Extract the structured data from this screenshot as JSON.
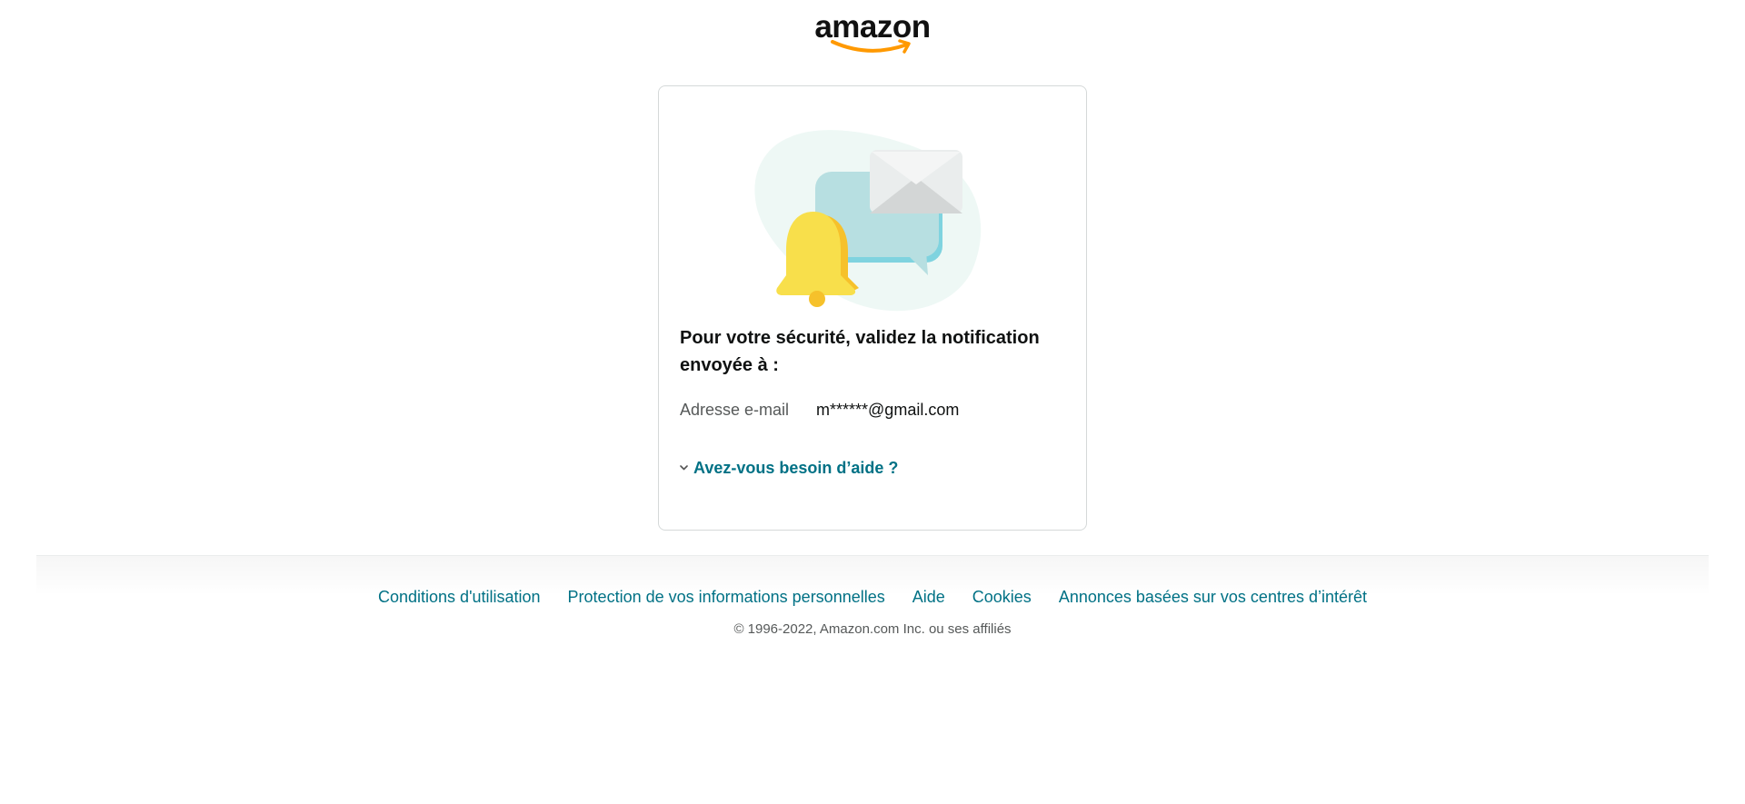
{
  "logo": {
    "text": "amazon",
    "accent_color": "#FF9900"
  },
  "card": {
    "heading": "Pour votre sécurité, validez la notification envoyée à :",
    "email_label": "Adresse e-mail",
    "email_value": "m******@gmail.com",
    "help_link": "Avez-vous besoin d’aide ?",
    "illustration_icons": [
      "bell-icon",
      "chat-bubble-icon",
      "envelope-icon"
    ]
  },
  "footer": {
    "links": [
      "Conditions d'utilisation",
      "Protection de vos informations personnelles",
      "Aide",
      "Cookies",
      "Annonces basées sur vos centres d’intérêt"
    ],
    "copyright": "© 1996-2022, Amazon.com Inc. ou ses affiliés"
  },
  "colors": {
    "link": "#007185",
    "text": "#0F1111",
    "muted": "#565959",
    "border": "#D5D9D9"
  }
}
